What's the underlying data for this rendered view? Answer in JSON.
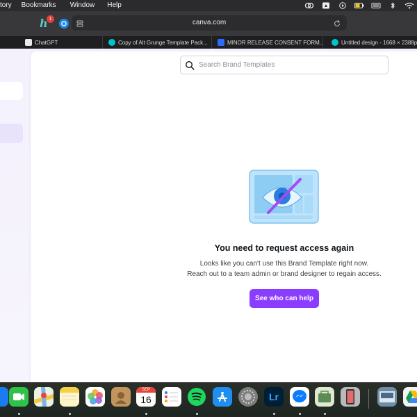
{
  "menubar": {
    "items": [
      "tory",
      "Bookmarks",
      "Window",
      "Help"
    ]
  },
  "toolbar": {
    "extension_badge": "1",
    "url": "canva.com"
  },
  "tabs": [
    {
      "title": "ChatGPT",
      "favicon_color": "#ffffff"
    },
    {
      "title": "Copy of Alt Grunge Template Pack...",
      "favicon_color": "#00c4cc"
    },
    {
      "title": "MINOR RELEASE CONSENT FORM...",
      "favicon_color": "#2b6cff"
    },
    {
      "title": "Untitled design - 1668 × 2388p...",
      "favicon_color": "#00c4cc"
    }
  ],
  "search": {
    "placeholder": "Search Brand Templates"
  },
  "empty_state": {
    "title": "You need to request access again",
    "line1": "Looks like you can't use this Brand Template right now.",
    "line2": "Reach out to a team admin or brand designer to regain access.",
    "button": "See who can help"
  },
  "dock": {
    "calendar_month": "SEP",
    "calendar_day": "16",
    "lightroom_label": "Lr"
  },
  "colors": {
    "accent": "#8b3dff",
    "page_bg": "#f3f1fb"
  }
}
